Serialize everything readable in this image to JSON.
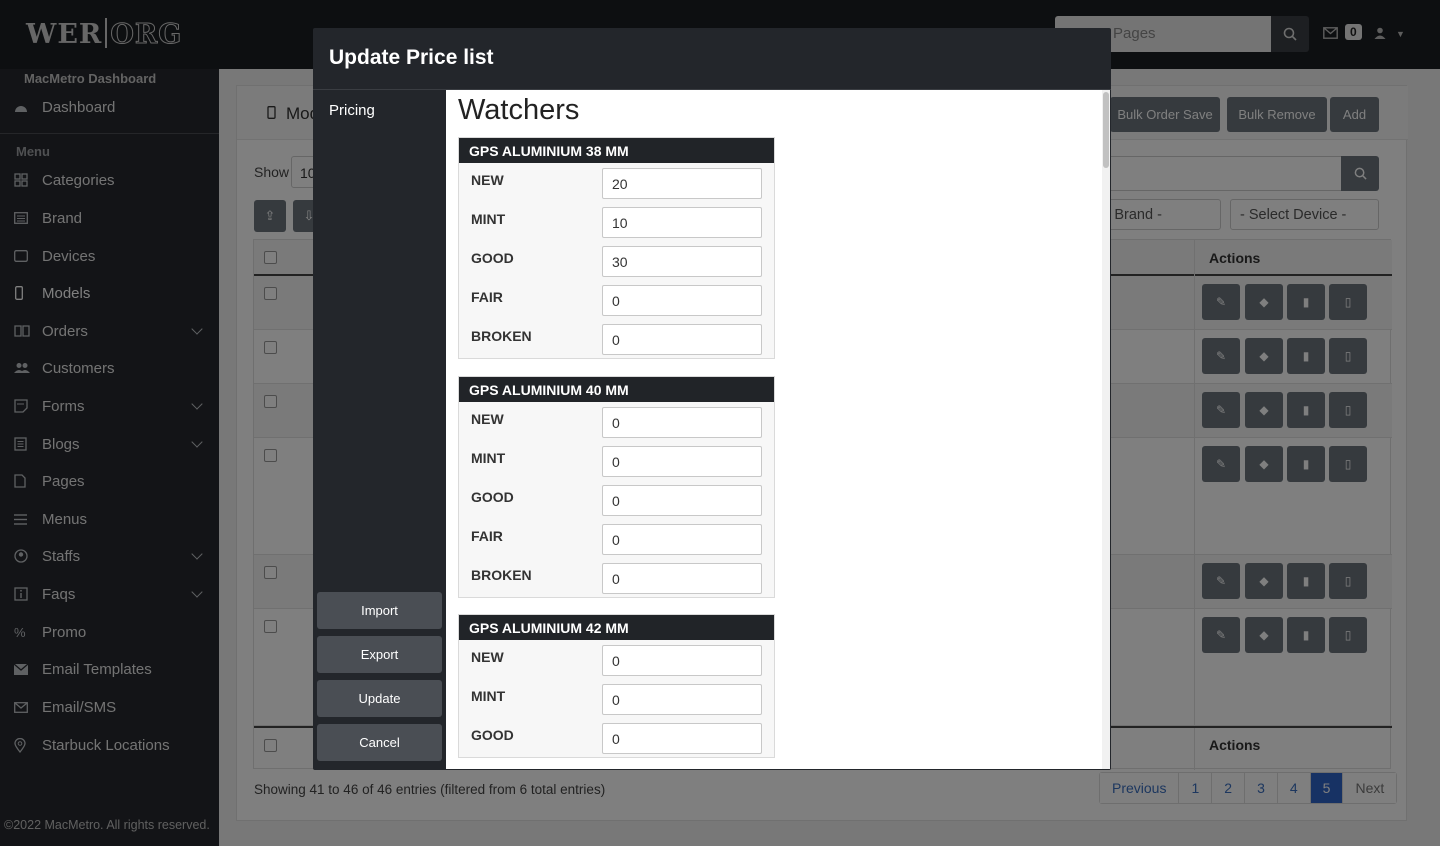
{
  "app": {
    "logo_left": "WER",
    "logo_right": "ORG",
    "search_placeholder": "Pages",
    "mail_count": "0"
  },
  "sidebar": {
    "dashboard_title": "MacMetro Dashboard",
    "dashboard_item": "Dashboard",
    "menu_label": "Menu",
    "items": [
      {
        "label": "Categories"
      },
      {
        "label": "Brand"
      },
      {
        "label": "Devices"
      },
      {
        "label": "Models"
      },
      {
        "label": "Orders"
      },
      {
        "label": "Customers"
      },
      {
        "label": "Forms"
      },
      {
        "label": "Blogs"
      },
      {
        "label": "Pages"
      },
      {
        "label": "Menus"
      },
      {
        "label": "Staffs"
      },
      {
        "label": "Faqs"
      },
      {
        "label": "Promo"
      },
      {
        "label": "Email Templates"
      },
      {
        "label": "Email/SMS"
      },
      {
        "label": "Starbuck Locations"
      }
    ],
    "footer": "©2022 MacMetro. All rights reserved."
  },
  "page": {
    "title_fragment": "Mod",
    "buttons": {
      "bulk_order_save": "Bulk Order Save",
      "bulk_remove": "Bulk Remove",
      "add": "Add"
    },
    "show_label": "Show",
    "show_value": "10",
    "select_brand": "ect Brand -",
    "select_device": "- Select Device -",
    "actions_header": "Actions",
    "showing": "Showing 41 to 46 of 46 entries (filtered from 6 total entries)",
    "pagination": {
      "previous": "Previous",
      "pages": [
        "1",
        "2",
        "3",
        "4",
        "5"
      ],
      "active": "5",
      "next": "Next"
    }
  },
  "modal": {
    "title": "Update Price list",
    "side_tab": "Pricing",
    "buttons": {
      "import": "Import",
      "export": "Export",
      "update": "Update",
      "cancel": "Cancel"
    },
    "section_title": "Watchers",
    "groups": [
      {
        "name": "GPS ALUMINIUM 38 MM",
        "rows": [
          {
            "label": "NEW",
            "value": "20"
          },
          {
            "label": "MINT",
            "value": "10"
          },
          {
            "label": "GOOD",
            "value": "30"
          },
          {
            "label": "FAIR",
            "value": "0"
          },
          {
            "label": "BROKEN",
            "value": "0"
          }
        ]
      },
      {
        "name": "GPS ALUMINIUM 40 MM",
        "rows": [
          {
            "label": "NEW",
            "value": "0"
          },
          {
            "label": "MINT",
            "value": "0"
          },
          {
            "label": "GOOD",
            "value": "0"
          },
          {
            "label": "FAIR",
            "value": "0"
          },
          {
            "label": "BROKEN",
            "value": "0"
          }
        ]
      },
      {
        "name": "GPS ALUMINIUM 42 MM",
        "rows": [
          {
            "label": "NEW",
            "value": "0"
          },
          {
            "label": "MINT",
            "value": "0"
          },
          {
            "label": "GOOD",
            "value": "0"
          }
        ]
      }
    ]
  }
}
